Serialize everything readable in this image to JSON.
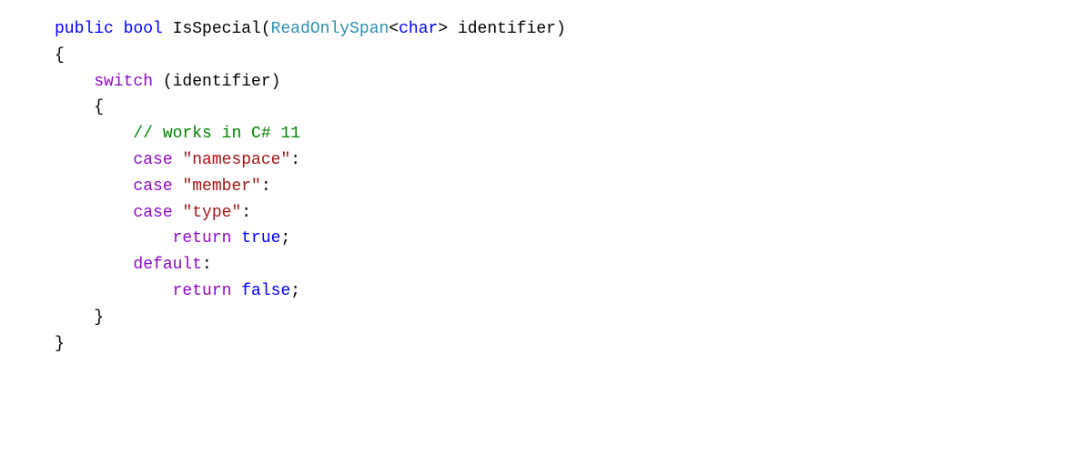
{
  "code": {
    "l1_public": "public",
    "l1_bool": "bool",
    "l1_method": " IsSpecial(",
    "l1_type": "ReadOnlySpan",
    "l1_lt": "<",
    "l1_char": "char",
    "l1_gt": ">",
    "l1_param": " identifier)",
    "l2_brace": "{",
    "l3_switch": "switch",
    "l3_rest": " (identifier)",
    "l4_brace": "    {",
    "l5_comment": "// works in C# 11",
    "l6_case": "case",
    "l6_str": " \"namespace\"",
    "l6_colon": ":",
    "l7_case": "case",
    "l7_str": " \"member\"",
    "l7_colon": ":",
    "l8_case": "case",
    "l8_str": " \"type\"",
    "l8_colon": ":",
    "l9_return": "return",
    "l9_true": "true",
    "l9_semi": ";",
    "l10_default": "default",
    "l10_colon": ":",
    "l11_return": "return",
    "l11_false": "false",
    "l11_semi": ";",
    "l12_brace": "    }",
    "l13_brace": "}"
  }
}
